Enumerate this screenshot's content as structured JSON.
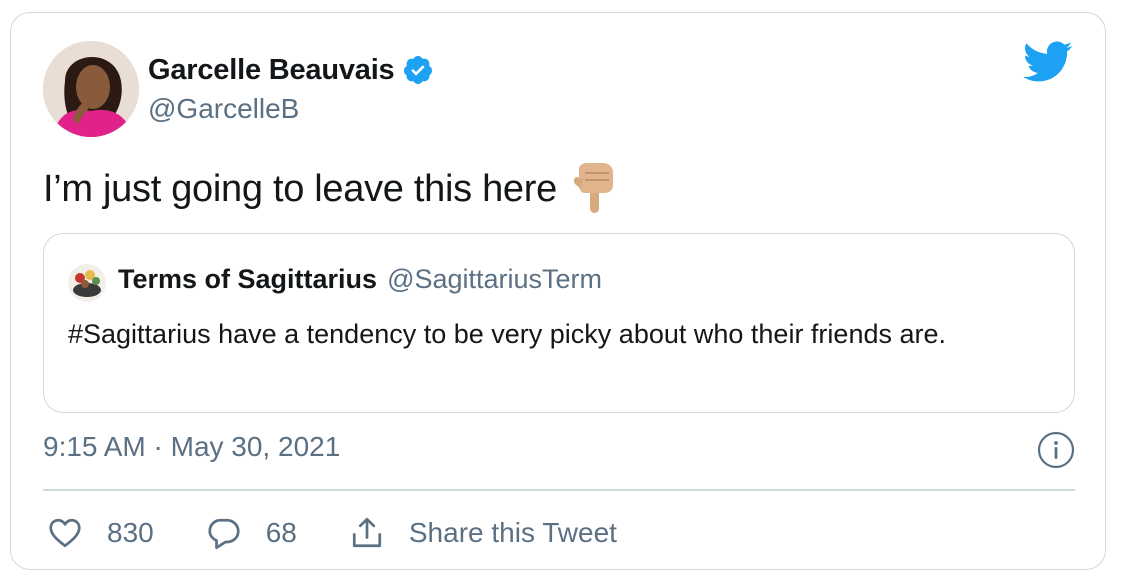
{
  "author": {
    "display_name": "Garcelle Beauvais",
    "handle": "@GarcelleB",
    "verified": true
  },
  "tweet": {
    "text": "I’m just going to leave this here"
  },
  "quoted_tweet": {
    "display_name": "Terms of Sagittarius",
    "handle": "@SagittariusTerm",
    "text": "#Sagittarius have a tendency to be very picky about who their friends are."
  },
  "timestamp": "9:15 AM · May 30, 2021",
  "actions": {
    "likes": "830",
    "replies": "68",
    "share_label": "Share this Tweet"
  },
  "icons": {
    "brand": "twitter-bird-icon",
    "verified": "verified-badge-icon",
    "pointing": "backhand-index-pointing-down-icon",
    "info": "info-icon",
    "like": "heart-icon",
    "reply": "reply-bubble-icon",
    "share": "share-icon"
  },
  "colors": {
    "brand_blue": "#1da1f2",
    "secondary_text": "#5b7083",
    "border": "#cfd9de"
  }
}
